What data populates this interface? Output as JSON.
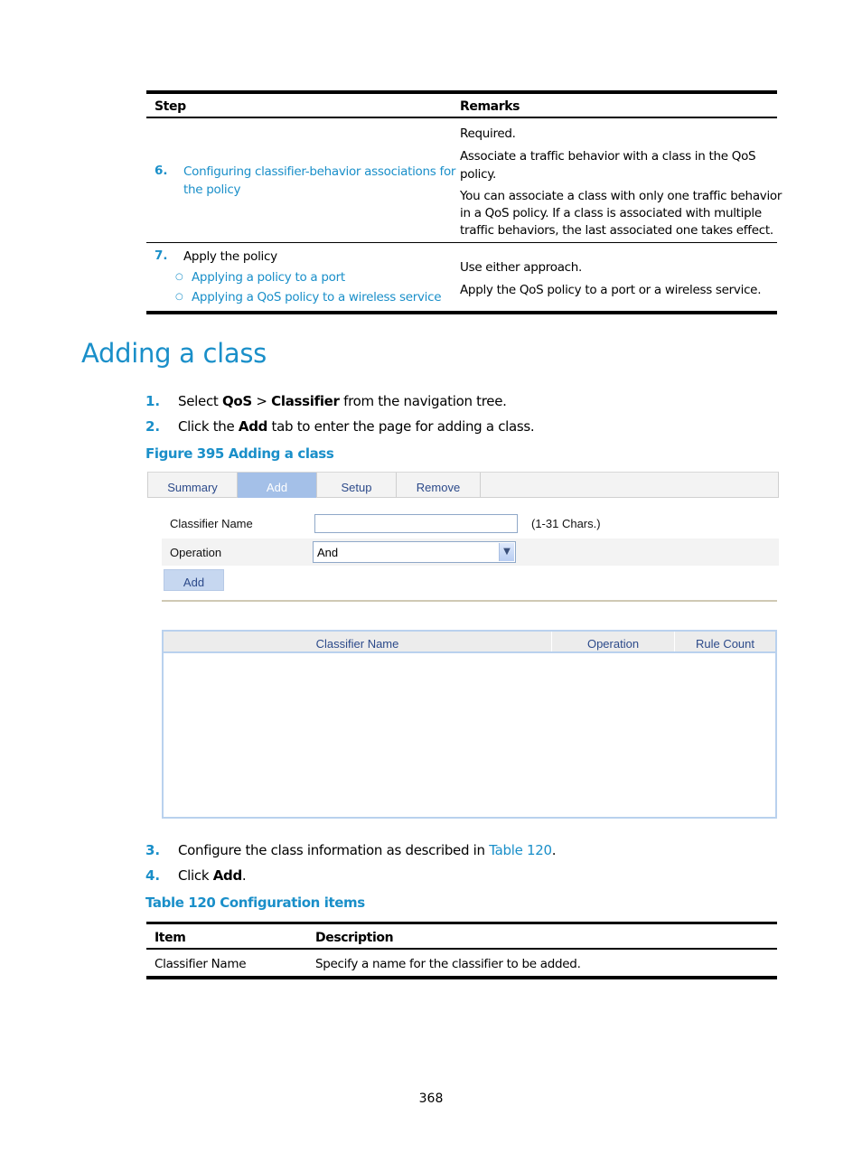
{
  "steps_table": {
    "headers": {
      "step": "Step",
      "remarks": "Remarks"
    },
    "rows": [
      {
        "number": "6.",
        "step_link_line1": "Configuring classifier-behavior associations for",
        "step_link_line2": "the policy",
        "remarks": [
          "Required.",
          "Associate a traffic behavior with a class in the QoS",
          "policy.",
          "You can associate a class with only one traffic behavior",
          "in a QoS policy. If a class is associated with multiple",
          "traffic behaviors, the last associated one takes effect."
        ]
      },
      {
        "number": "7.",
        "step_text": "Apply the policy",
        "sub_links": [
          "Applying a policy to a port",
          "Applying a QoS policy to a wireless service"
        ],
        "bullet": "○",
        "remarks": [
          "Use either approach.",
          "Apply the QoS policy to a port or a wireless service."
        ]
      }
    ]
  },
  "section": {
    "title": "Adding a class",
    "steps_a": [
      {
        "number": "1.",
        "pre": "Select ",
        "b1": "QoS",
        "mid": " > ",
        "b2": "Classifier",
        "post": " from the navigation tree."
      },
      {
        "number": "2.",
        "pre": "Click the ",
        "b1": "Add",
        "post": " tab to enter the page for adding a class."
      }
    ],
    "figure_caption": "Figure 395 Adding a class"
  },
  "ui": {
    "tabs": [
      {
        "label": "Summary",
        "active": false
      },
      {
        "label": "Add",
        "active": true
      },
      {
        "label": "Setup",
        "active": false
      },
      {
        "label": "Remove",
        "active": false
      }
    ],
    "form": {
      "classifier_name_label": "Classifier Name",
      "classifier_name_value": "",
      "classifier_name_hint": "(1-31 Chars.)",
      "operation_label": "Operation",
      "operation_value": "And",
      "add_button": "Add"
    },
    "grid": {
      "columns": [
        "Classifier Name",
        "Operation",
        "Rule Count"
      ],
      "rows": []
    }
  },
  "steps_b": [
    {
      "number": "3.",
      "pre": "Configure the class information as described in ",
      "link": "Table 120",
      "post": "."
    },
    {
      "number": "4.",
      "pre": "Click ",
      "b1": "Add",
      "post": "."
    }
  ],
  "config_table": {
    "caption": "Table 120 Configuration items",
    "headers": {
      "item": "Item",
      "description": "Description"
    },
    "rows": [
      {
        "item": "Classifier Name",
        "description": "Specify a name for the classifier to be added."
      }
    ]
  },
  "page_number": "368"
}
